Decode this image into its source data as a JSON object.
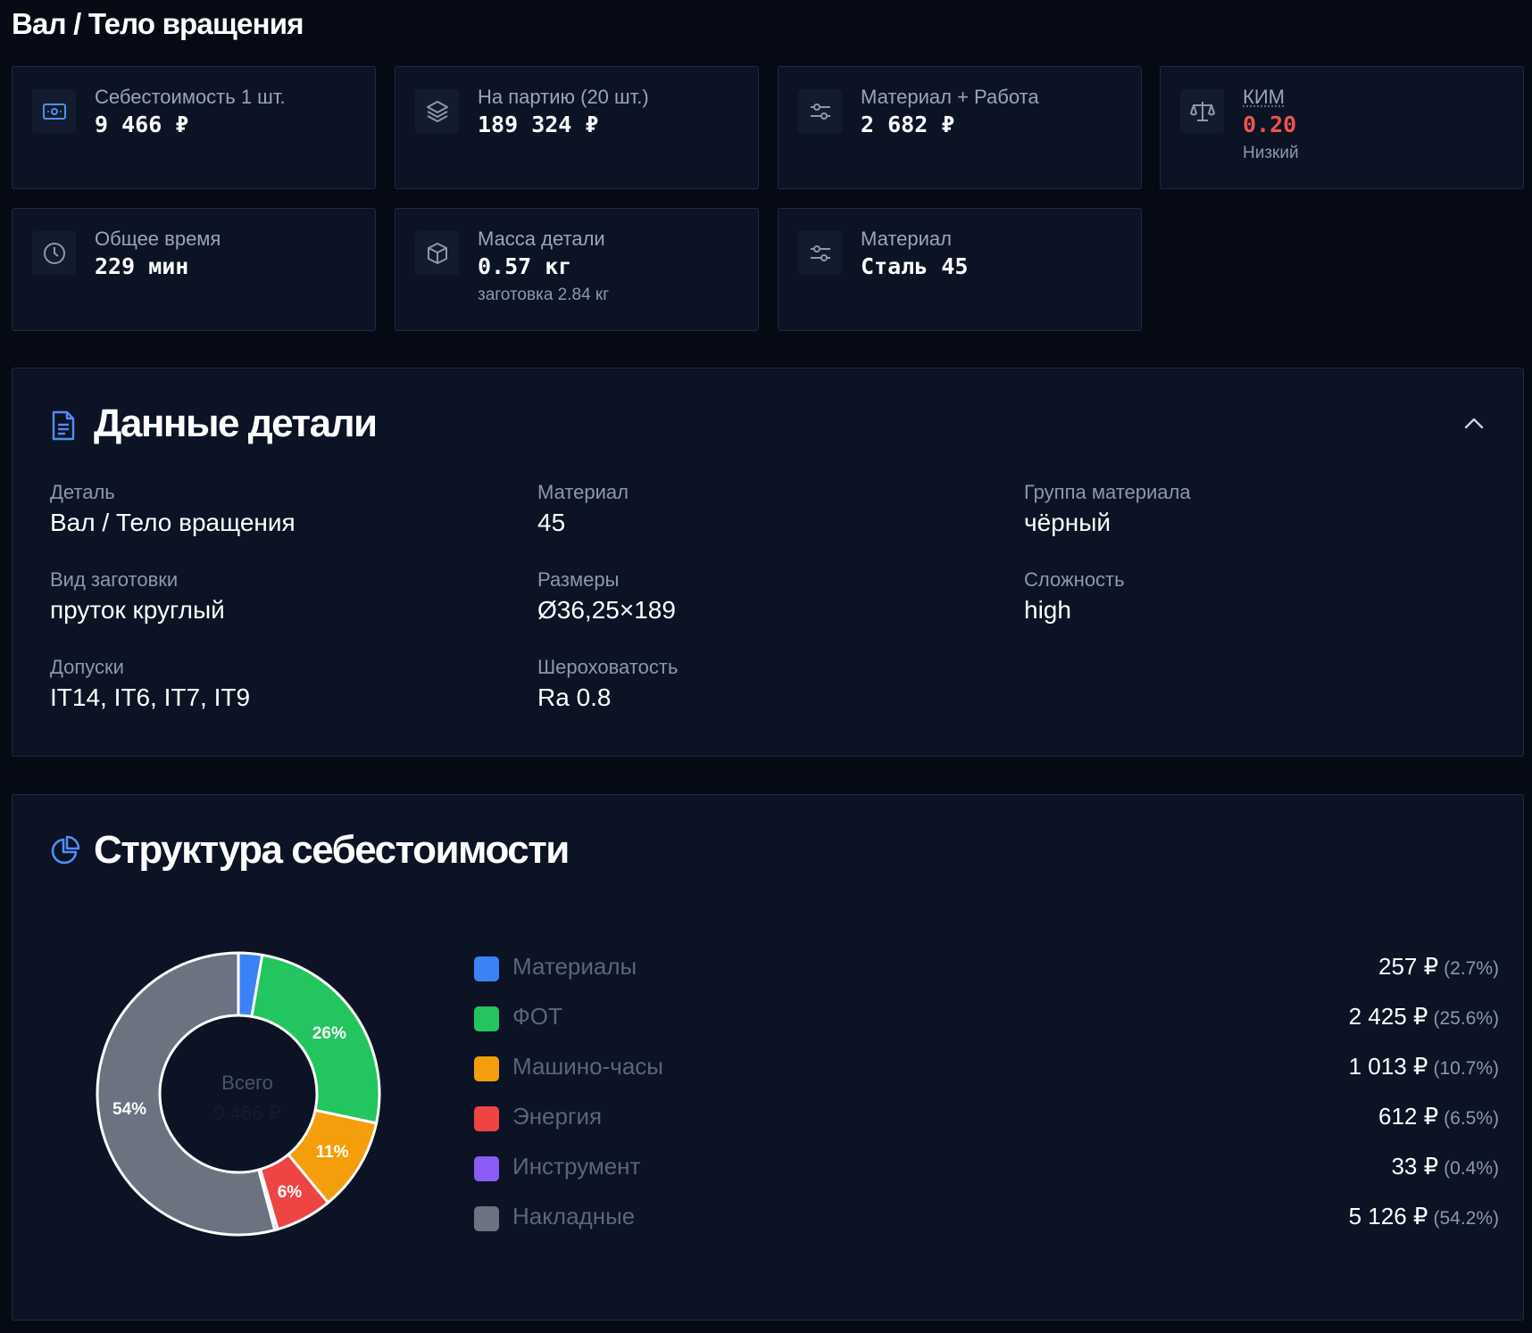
{
  "page": {
    "title": "Вал / Тело вращения"
  },
  "cards": [
    {
      "icon": "banknote-icon",
      "label": "Себестоимость 1 шт.",
      "value": "9 466 ₽",
      "sub": ""
    },
    {
      "icon": "layers-icon",
      "label": "На партию (20 шт.)",
      "value": "189 324 ₽",
      "sub": ""
    },
    {
      "icon": "sliders-icon",
      "label": "Материал + Работа",
      "value": "2 682 ₽",
      "sub": ""
    },
    {
      "icon": "scale-icon",
      "label": "КИМ",
      "value": "0.20",
      "sub": "Низкий",
      "value_color": "#ef5350"
    },
    {
      "icon": "clock-icon",
      "label": "Общее время",
      "value": "229 мин",
      "sub": ""
    },
    {
      "icon": "box-icon",
      "label": "Масса детали",
      "value": "0.57 кг",
      "sub": "заготовка 2.84 кг"
    },
    {
      "icon": "sliders-icon",
      "label": "Материал",
      "value": "Сталь 45",
      "sub": ""
    }
  ],
  "details": {
    "title": "Данные детали",
    "icon": "document-icon",
    "toggle_icon": "chevron-up-icon",
    "fields": [
      {
        "label": "Деталь",
        "value": "Вал / Тело вращения"
      },
      {
        "label": "Материал",
        "value": "45"
      },
      {
        "label": "Группа материала",
        "value": "чёрный"
      },
      {
        "label": "Вид заготовки",
        "value": "пруток круглый"
      },
      {
        "label": "Размеры",
        "value": "Ø36,25×189"
      },
      {
        "label": "Сложность",
        "value": "high"
      },
      {
        "label": "Допуски",
        "value": "IT14, IT6, IT7, IT9"
      },
      {
        "label": "Шероховатость",
        "value": "Ra 0.8"
      }
    ]
  },
  "structure": {
    "title": "Структура себестоимости",
    "icon": "pie-chart-icon",
    "center_label": "Всего",
    "center_value": "9 466 ₽"
  },
  "chart_data": {
    "type": "pie",
    "title": "Структура себестоимости",
    "categories": [
      "Материалы",
      "ФОТ",
      "Машино-часы",
      "Энергия",
      "Инструмент",
      "Накладные"
    ],
    "values": [
      257,
      2425,
      1013,
      612,
      33,
      5126
    ],
    "amount_labels": [
      "257 ₽",
      "2 425 ₽",
      "1 013 ₽",
      "612 ₽",
      "33 ₽",
      "5 126 ₽"
    ],
    "percent_labels": [
      "(2.7%)",
      "(25.6%)",
      "(10.7%)",
      "(6.5%)",
      "(0.4%)",
      "(54.2%)"
    ],
    "slice_labels": [
      "",
      "26%",
      "11%",
      "6%",
      "",
      "54%"
    ],
    "colors": [
      "#3b82f6",
      "#22c55e",
      "#f59e0b",
      "#ef4444",
      "#8b5cf6",
      "#6b7280"
    ],
    "total": "9 466 ₽",
    "legend": "right"
  }
}
